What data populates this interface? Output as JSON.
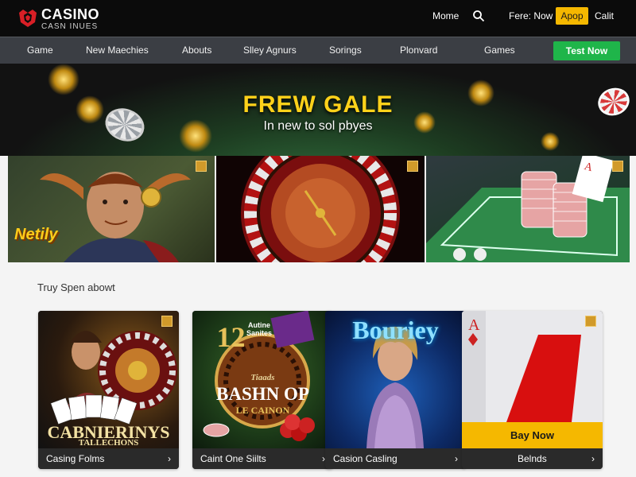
{
  "brand": {
    "name": "CASINO",
    "tagline": "CASN INUES"
  },
  "header": {
    "home": "Mome",
    "free_now": "Fere: Now",
    "cta": "Apop",
    "cart": "Calit"
  },
  "nav": {
    "items": [
      "Game",
      "New Maechies",
      "Abouts",
      "Slley Agnurs",
      "Sorings",
      "Plonvard",
      "Games"
    ],
    "cta": "Test Now"
  },
  "hero": {
    "title": "FREW GALE",
    "subtitle": "In new to sol pbyes"
  },
  "panels": {
    "p1_text": "Netily"
  },
  "section": {
    "title": "Truy Spen abowt"
  },
  "cards": [
    {
      "label": "Casing Folms",
      "big": "CABNIERINYS",
      "small": "TALLECHONS"
    },
    {
      "label": "Caint One Siilts",
      "number": "12",
      "big": "BASHN OP",
      "small": "LE CAINON",
      "ribbon": "Autine Sanites",
      "small_top": "Tiaads"
    },
    {
      "label": "Casion Casling",
      "big": "Bouriey"
    },
    {
      "label": "Belnds",
      "cta": "Bay Now"
    }
  ],
  "colors": {
    "accent": "#f5b800",
    "cta_green": "#1fb54a",
    "nav_bg": "#3b3e44",
    "header_bg": "#0b0b0b"
  }
}
